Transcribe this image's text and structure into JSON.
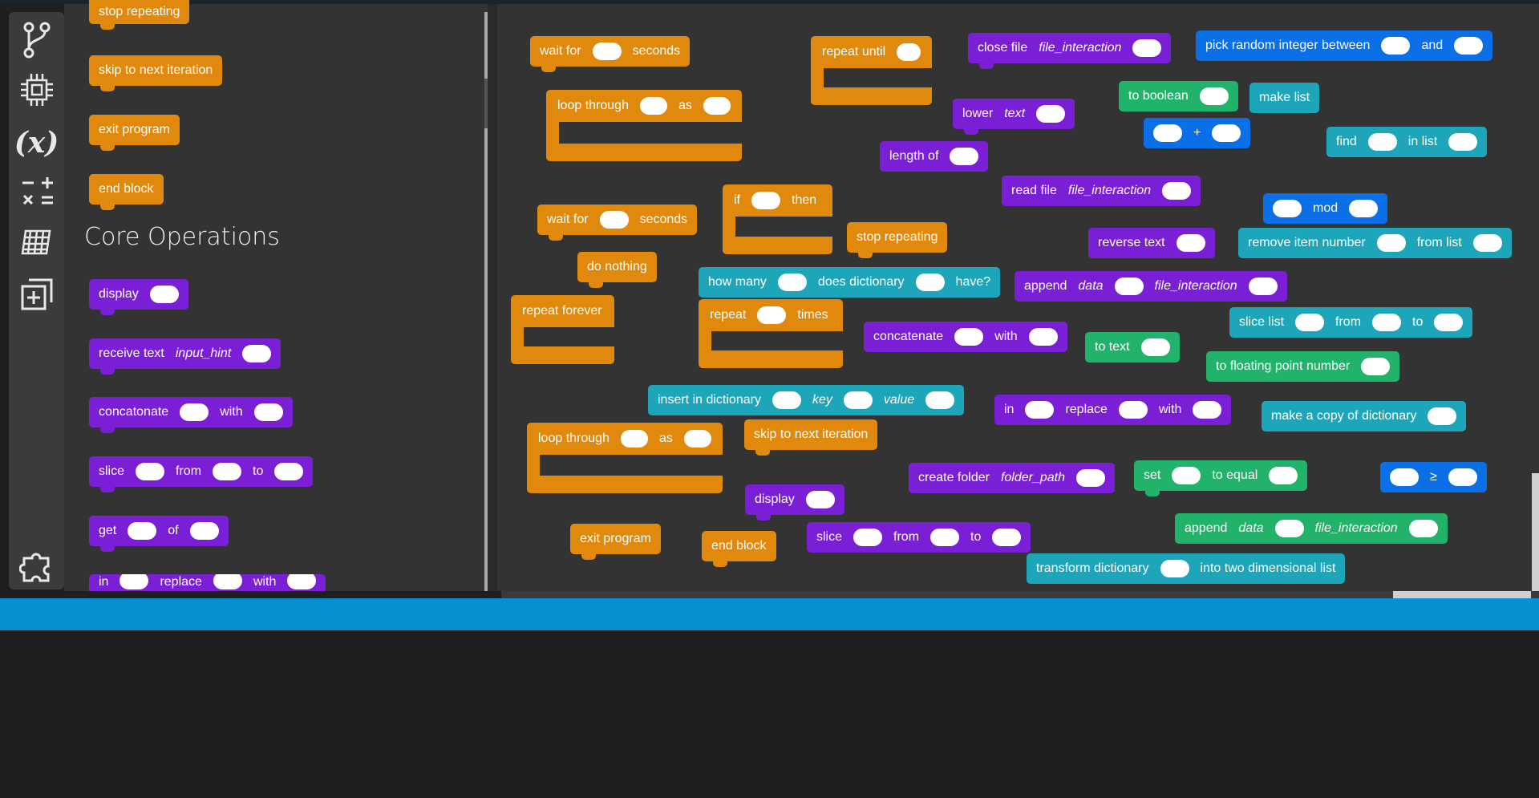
{
  "toolbar": {
    "icons": [
      "branch-icon",
      "chip-icon",
      "variable-icon",
      "math-icon",
      "grid-icon",
      "add-icon",
      "puzzle-icon"
    ],
    "variable_label": "(x)"
  },
  "palette": {
    "section_title": "Core Operations",
    "blocks_top": [
      "stop repeating",
      "skip to next iteration",
      "exit program",
      "end block"
    ],
    "display": "display",
    "receive_text": "receive text",
    "input_hint": "input_hint",
    "concat": "concatonate",
    "with": "with",
    "slice": "slice",
    "from": "from",
    "to": "to",
    "get": "get",
    "of": "of",
    "in": "in",
    "replace": "replace"
  },
  "ws": {
    "wait_for": "wait for",
    "seconds": "seconds",
    "repeat_until": "repeat until",
    "close_file": "close file",
    "file_interaction": "file_interaction",
    "pick_random": "pick random integer between",
    "and": "and",
    "loop_through": "loop through",
    "as": "as",
    "to_boolean": "to boolean",
    "make_list": "make list",
    "lower": "lower",
    "text": "text",
    "plus": "+",
    "find": "find",
    "in_list": "in list",
    "length_of": "length of",
    "read_file": "read file",
    "mod": "mod",
    "if": "if",
    "then": "then",
    "stop_repeating": "stop repeating",
    "reverse_text": "reverse text",
    "remove_item": "remove item number",
    "from_list": "from list",
    "do_nothing": "do nothing",
    "how_many": "how many",
    "does_dict": "does dictionary",
    "have": "have?",
    "append": "append",
    "data": "data",
    "repeat_forever": "repeat forever",
    "repeat": "repeat",
    "times": "times",
    "concat": "concatenate",
    "with": "with",
    "to_text": "to text",
    "slice_list": "slice list",
    "from": "from",
    "to": "to",
    "to_float": "to floating point number",
    "insert_dict": "insert in dictionary",
    "key": "key",
    "value": "value",
    "in": "in",
    "replace": "replace",
    "skip": "skip to next iteration",
    "make_copy": "make a copy of dictionary",
    "create_folder": "create folder",
    "folder_path": "folder_path",
    "set": "set",
    "to_equal": "to equal",
    "gte": "≥",
    "display": "display",
    "exit_program": "exit program",
    "end_block": "end block",
    "slice": "slice",
    "transform": "transform dictionary",
    "into_2d": "into two dimensional list"
  }
}
